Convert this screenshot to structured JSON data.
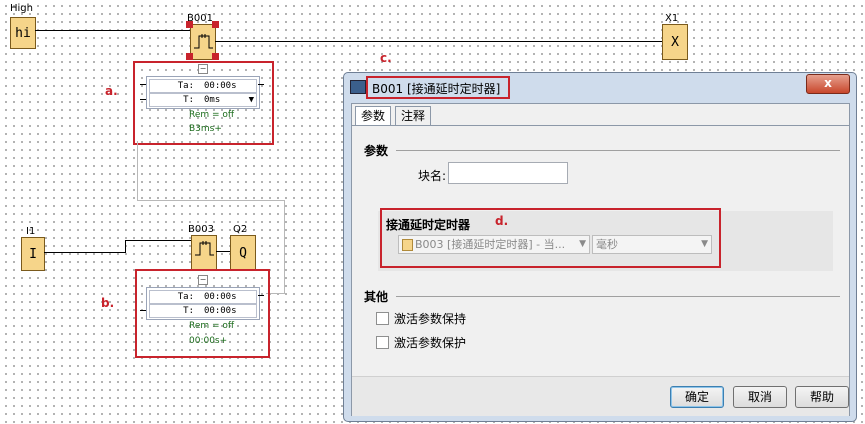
{
  "diagram": {
    "input_high": {
      "label": "High",
      "value": "hi"
    },
    "output_x1": {
      "label": "X1",
      "value": "X"
    },
    "block_b001": {
      "label": "B001"
    },
    "block_b003": {
      "label": "B003"
    },
    "input_i1": {
      "label": "I1",
      "value": "I"
    },
    "output_q2": {
      "label": "Q2",
      "value": "Q"
    },
    "param_a": {
      "ta_key": "Ta:",
      "ta_value": "00:00s",
      "t_key": "T:",
      "t_value": "0ms",
      "rem": "Rem = off",
      "ref": "B3ms+"
    },
    "param_b": {
      "ta_key": "Ta:",
      "ta_value": "00:00s",
      "t_key": "T:",
      "t_value": "00:00s",
      "rem": "Rem = off",
      "ref": "00:00s+"
    },
    "annotations": {
      "a": "a.",
      "b": "b.",
      "c": "c.",
      "d": "d."
    },
    "accent_red": "#c8232c"
  },
  "dialog": {
    "title": "B001 [接通延时定时器]",
    "close_label": "x",
    "tabs": [
      "参数",
      "注释"
    ],
    "params_group": "参数",
    "block_name_label": "块名:",
    "block_name_value": "",
    "timer_group": "接通延时定时器",
    "ref_combo": "B003 [接通延时定时器] - 当...",
    "unit_combo": "毫秒",
    "other_group": "其他",
    "chk_retentive": "激活参数保持",
    "chk_protect": "激活参数保护",
    "buttons": {
      "ok": "确定",
      "cancel": "取消",
      "help": "帮助"
    }
  }
}
